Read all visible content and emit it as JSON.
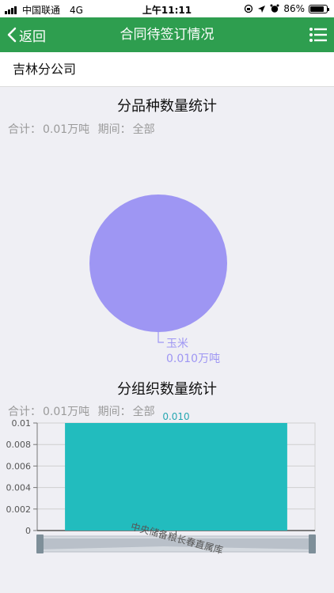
{
  "status_bar": {
    "carrier": "中国联通",
    "network": "4G",
    "time": "上午11:11",
    "battery": "86%",
    "battery_level": 0.86
  },
  "nav": {
    "back_label": "返回",
    "title": "合同待签订情况",
    "menu_icon": "list-menu-icon"
  },
  "company": {
    "name": "吉林分公司"
  },
  "variety_section": {
    "title": "分品种数量统计",
    "total_label": "合计：",
    "total_value": "0.01万吨",
    "period_label": "期间：",
    "period_value": "全部"
  },
  "org_section": {
    "title": "分组织数量统计",
    "total_label": "合计：",
    "total_value": "0.01万吨",
    "period_label": "期间：",
    "period_value": "全部"
  },
  "colors": {
    "nav_green": "#2e9e4f",
    "pie_purple": "#9e96f3",
    "bar_teal": "#22bcbe",
    "label_teal": "#27a7b2"
  },
  "chart_data": [
    {
      "type": "pie",
      "title": "分品种数量统计",
      "slices": [
        {
          "label": "玉米",
          "value": 0.01,
          "value_label": "0.010万吨"
        }
      ]
    },
    {
      "type": "bar",
      "title": "分组织数量统计",
      "categories": [
        "中央储备粮长春直属库"
      ],
      "values": [
        0.01
      ],
      "data_labels": [
        "0.010"
      ],
      "ylim": [
        0,
        0.01
      ],
      "yticks": [
        "0",
        "0.002",
        "0.004",
        "0.006",
        "0.008",
        "0.01"
      ],
      "grid": true
    }
  ]
}
